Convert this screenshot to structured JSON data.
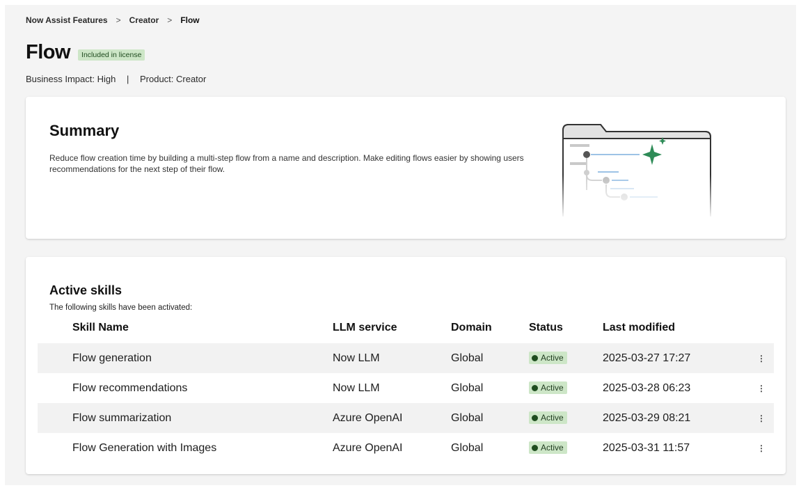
{
  "breadcrumb": {
    "items": [
      "Now Assist Features",
      "Creator",
      "Flow"
    ],
    "separator": ">"
  },
  "header": {
    "title": "Flow",
    "badge": "Included in license",
    "business_impact": "Business Impact: High",
    "meta_separator": "|",
    "product": "Product: Creator"
  },
  "summary": {
    "title": "Summary",
    "description": "Reduce flow creation time by building a multi-step flow from a name and description. Make editing flows easier by showing users recommendations for the next step of their flow."
  },
  "skills": {
    "title": "Active skills",
    "subtitle": "The following skills have been activated:",
    "columns": [
      "Skill Name",
      "LLM service",
      "Domain",
      "Status",
      "Last modified"
    ],
    "rows": [
      {
        "name": "Flow generation",
        "llm": "Now LLM",
        "domain": "Global",
        "status": "Active",
        "modified": "2025-03-27 17:27"
      },
      {
        "name": "Flow recommendations",
        "llm": "Now LLM",
        "domain": "Global",
        "status": "Active",
        "modified": "2025-03-28 06:23"
      },
      {
        "name": "Flow summarization",
        "llm": "Azure OpenAI",
        "domain": "Global",
        "status": "Active",
        "modified": "2025-03-29 08:21"
      },
      {
        "name": "Flow Generation with Images",
        "llm": "Azure OpenAI",
        "domain": "Global",
        "status": "Active",
        "modified": "2025-03-31 11:57"
      }
    ],
    "row_menu_icon": "kebab-icon",
    "more_glyph": "⋮"
  },
  "colors": {
    "accent_green": "#2e8b57",
    "badge_bg": "#cde6c7",
    "status_dot": "#1f4d1f"
  }
}
